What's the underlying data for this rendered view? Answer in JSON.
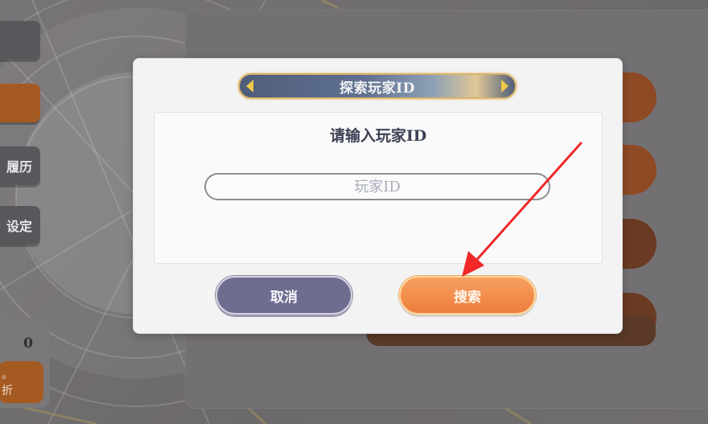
{
  "background": {
    "left_tabs": [
      {
        "label": "",
        "color": "#58575b"
      },
      {
        "label": "",
        "color": "#a55a22"
      },
      {
        "label": "履历",
        "color": "#58575b"
      },
      {
        "label": "设定",
        "color": "#58575b"
      }
    ],
    "left_card": {
      "value": "0",
      "button_label_line1": "。",
      "button_label_line2": "折"
    }
  },
  "dialog": {
    "title": "探索玩家ID",
    "prompt": "请输入玩家ID",
    "input": {
      "value": "",
      "placeholder": "玩家ID"
    },
    "cancel_label": "取消",
    "search_label": "搜索"
  },
  "colors": {
    "accent_orange": "#ef7d3e",
    "cancel_purple": "#6e6d90",
    "annotation_arrow": "#f02828"
  },
  "annotation": {
    "type": "arrow",
    "points_to": "search-button"
  }
}
